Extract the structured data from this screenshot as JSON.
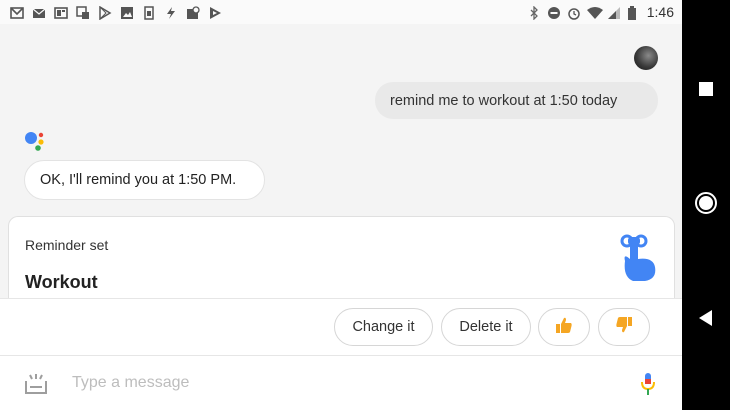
{
  "status_bar": {
    "time": "1:46",
    "left_icons": [
      "gmail-icon",
      "mail-icon",
      "news-icon",
      "photos-icon",
      "play-store-icon",
      "image-icon",
      "sim-icon",
      "flash-icon",
      "maps-icon",
      "play-icon"
    ],
    "right_icons": [
      "bluetooth-icon",
      "do-not-disturb-icon",
      "alarm-icon",
      "wifi-icon",
      "signal-icon",
      "battery-icon"
    ]
  },
  "conversation": {
    "user_message": "remind me to workout at 1:50 today",
    "assistant_message": "OK, I'll remind you at 1:50 PM."
  },
  "reminder_card": {
    "title": "Reminder set",
    "name": "Workout",
    "icon": "reminder-finger-icon"
  },
  "suggestions": {
    "change": "Change it",
    "delete": "Delete it",
    "thumbs_up": "thumbs-up-icon",
    "thumbs_down": "thumbs-down-icon"
  },
  "input": {
    "placeholder": "Type a message",
    "value": ""
  },
  "nav_bar": {
    "buttons": [
      "recents-button",
      "home-button",
      "back-button"
    ]
  },
  "colors": {
    "google_blue": "#4285F4",
    "google_red": "#EA4335",
    "google_yellow": "#FBBC05",
    "google_green": "#34A853",
    "thumb": "#F5A623"
  }
}
